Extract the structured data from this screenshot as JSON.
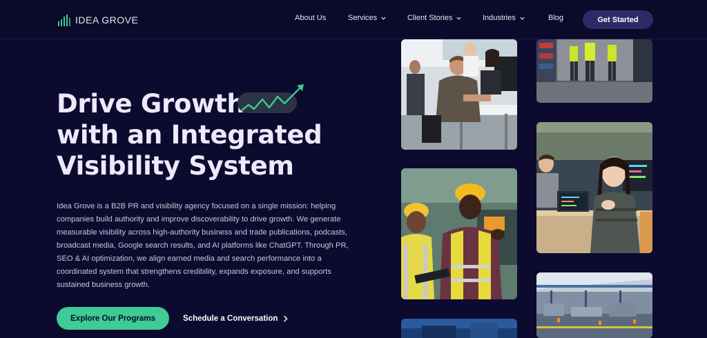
{
  "brand": {
    "name": "IDEA GROVE",
    "accent": "#3ecb94",
    "background": "#0c0a2e"
  },
  "nav": {
    "items": [
      {
        "label": "About Us",
        "has_dropdown": false
      },
      {
        "label": "Services",
        "has_dropdown": true
      },
      {
        "label": "Client Stories",
        "has_dropdown": true
      },
      {
        "label": "Industries",
        "has_dropdown": true
      },
      {
        "label": "Blog",
        "has_dropdown": false
      }
    ],
    "cta_label": "Get Started"
  },
  "hero": {
    "title_lines": [
      "Drive Growth",
      "with an Integrated",
      "Visibility System"
    ],
    "description": "Idea Grove is a B2B PR and visibility agency focused on a single mission: helping companies build authority and improve discoverability to drive growth. We generate measurable visibility across high-authority business and trade publications, podcasts, broadcast media, Google search results, and AI platforms like ChatGPT. Through PR, SEO & AI optimization, we align earned media and search performance into a coordinated system that strengthens credibility, expands exposure, and supports sustained business growth.",
    "primary_button": "Explore Our Programs",
    "secondary_link": "Schedule a Conversation"
  },
  "photos": [
    {
      "name": "office-workers-photo"
    },
    {
      "name": "warehouse-workers-photo"
    },
    {
      "name": "factory-engineers-photo"
    },
    {
      "name": "developer-laptop-photo"
    },
    {
      "name": "manufacturing-floor-photo"
    },
    {
      "name": "blue-photo-bottom"
    }
  ]
}
